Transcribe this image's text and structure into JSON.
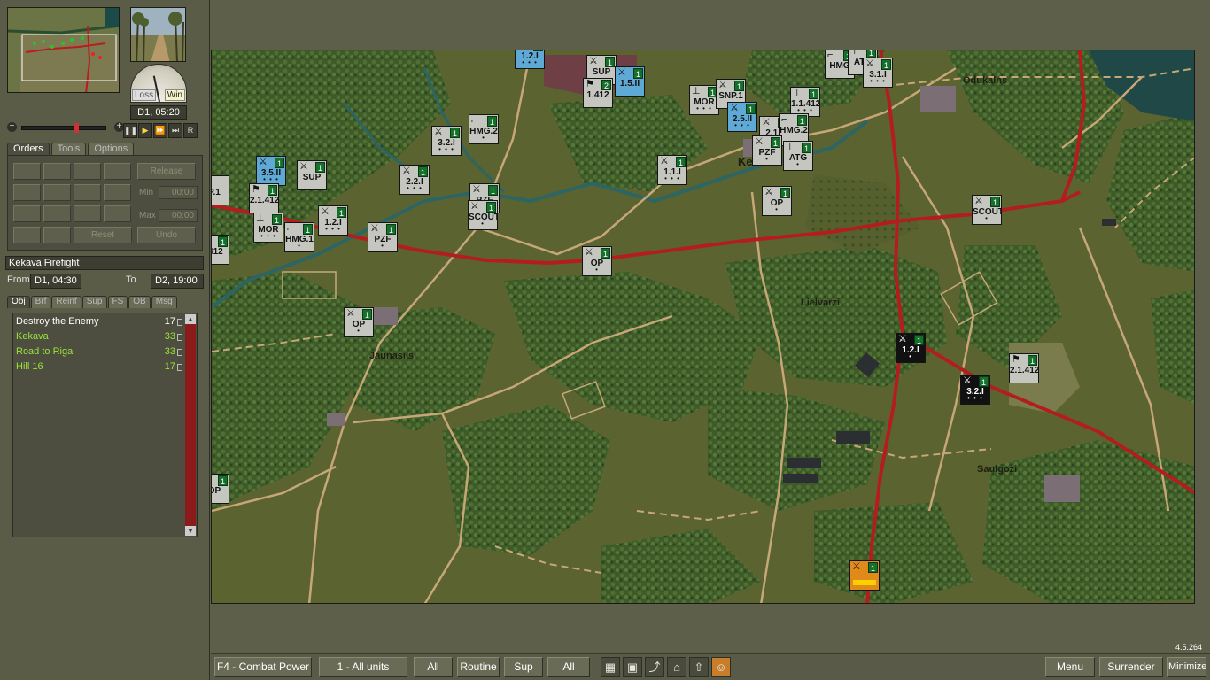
{
  "left_panel": {
    "gauge": {
      "loss_label": "Loss",
      "win_label": "Win"
    },
    "turn_time": "D1, 05:20",
    "playback": {
      "pause": "❚❚",
      "play": "▶",
      "fast": "⏩",
      "faster": "⏭",
      "reset": "R"
    },
    "tabs_top": [
      "Orders",
      "Tools",
      "Options"
    ],
    "orders": {
      "release_label": "Release",
      "min_label": "Min",
      "min_value": "00:00",
      "max_label": "Max",
      "max_value": "00:00",
      "reset_label": "Reset",
      "undo_label": "Undo"
    },
    "scenario_name": "Kekava Firefight",
    "from_label": "From",
    "from_value": "D1, 04:30",
    "to_label": "To",
    "to_value": "D2, 19:00",
    "tabs_bottom": [
      "Obj",
      "Brf",
      "Reinf",
      "Sup",
      "FS",
      "OB",
      "Msg"
    ],
    "objectives": [
      {
        "name": "Destroy the Enemy",
        "points": "17",
        "color": "#ffffff"
      },
      {
        "name": "Kekava",
        "points": "33",
        "color": "#9ae23a"
      },
      {
        "name": "Road to Riga",
        "points": "33",
        "color": "#9ae23a"
      },
      {
        "name": "Hill 16",
        "points": "17",
        "color": "#9ae23a"
      }
    ]
  },
  "map": {
    "towns": [
      {
        "name": "Odukalns"
      },
      {
        "name": "Kekava"
      },
      {
        "name": "Lielvarzi"
      },
      {
        "name": "Jaunasils"
      },
      {
        "name": "Saulgozi"
      }
    ],
    "units": [
      {
        "name": "1.2.I",
        "icon": "infantry-icon",
        "level": "1",
        "size": "• • •",
        "style": "blue"
      },
      {
        "name": "SUP",
        "icon": "infantry-icon",
        "level": "1",
        "size": "",
        "style": "grey"
      },
      {
        "name": "1.5.II",
        "icon": "infantry-icon",
        "level": "1",
        "size": "",
        "style": "blue"
      },
      {
        "name": "1.412",
        "icon": "hq-icon",
        "level": "2",
        "size": "",
        "style": "grey"
      },
      {
        "name": "HMG",
        "icon": "mg-icon",
        "level": "1",
        "size": "",
        "style": "grey"
      },
      {
        "name": "ATG",
        "icon": "gun-icon",
        "level": "1",
        "size": "",
        "style": "grey"
      },
      {
        "name": "3.1.I",
        "icon": "infantry-icon",
        "level": "1",
        "size": "• • •",
        "style": "grey"
      },
      {
        "name": "MOR",
        "icon": "mortar-icon",
        "level": "1",
        "size": "• • •",
        "style": "grey"
      },
      {
        "name": "SNP.1",
        "icon": "infantry-icon",
        "level": "1",
        "size": "",
        "style": "grey"
      },
      {
        "name": "2.5.II",
        "icon": "infantry-icon",
        "level": "1",
        "size": "• • •",
        "style": "blue"
      },
      {
        "name": "1.1.412",
        "icon": "gun-icon",
        "level": "1",
        "size": "• • •",
        "style": "grey"
      },
      {
        "name": "2.1.I",
        "icon": "infantry-icon",
        "level": "1",
        "size": "• • •",
        "style": "grey"
      },
      {
        "name": "HMG.2",
        "icon": "mg-icon",
        "level": "1",
        "size": "",
        "style": "grey"
      },
      {
        "name": "PZF",
        "icon": "infantry-icon",
        "level": "1",
        "size": "•",
        "style": "grey"
      },
      {
        "name": "ATG",
        "icon": "gun-icon",
        "level": "1",
        "size": "•",
        "style": "grey"
      },
      {
        "name": "1.1.I",
        "icon": "infantry-icon",
        "level": "1",
        "size": "• • •",
        "style": "grey"
      },
      {
        "name": "OP",
        "icon": "infantry-icon",
        "level": "1",
        "size": "•",
        "style": "grey"
      },
      {
        "name": "3.2.I",
        "icon": "infantry-icon",
        "level": "1",
        "size": "• • •",
        "style": "grey"
      },
      {
        "name": "HMG.2",
        "icon": "mg-icon",
        "level": "1",
        "size": "•",
        "style": "grey"
      },
      {
        "name": "2.2.I",
        "icon": "infantry-icon",
        "level": "1",
        "size": "• • •",
        "style": "grey"
      },
      {
        "name": "PZF",
        "icon": "infantry-icon",
        "level": "1",
        "size": "•",
        "style": "grey"
      },
      {
        "name": "3.5.II",
        "icon": "infantry-icon",
        "level": "1",
        "size": "• • •",
        "style": "blue"
      },
      {
        "name": "SUP",
        "icon": "infantry-icon",
        "level": "1",
        "size": "",
        "style": "grey"
      },
      {
        "name": "2.1.412",
        "icon": "hq-icon",
        "level": "1",
        "size": "",
        "style": "grey"
      },
      {
        "name": "1.2.I",
        "icon": "infantry-icon",
        "level": "1",
        "size": "• • •",
        "style": "grey"
      },
      {
        "name": "MOR",
        "icon": "mortar-icon",
        "level": "1",
        "size": "• • •",
        "style": "grey"
      },
      {
        "name": "HMG.1",
        "icon": "mg-icon",
        "level": "1",
        "size": "•",
        "style": "grey"
      },
      {
        "name": "PZF",
        "icon": "infantry-icon",
        "level": "1",
        "size": "•",
        "style": "grey"
      },
      {
        "name": "OP",
        "icon": "infantry-icon",
        "level": "1",
        "size": "•",
        "style": "grey"
      },
      {
        "name": "SCOUT",
        "icon": "infantry-icon",
        "level": "1",
        "size": "•",
        "style": "grey"
      },
      {
        "name": "OP",
        "icon": "infantry-icon",
        "level": "1",
        "size": "•",
        "style": "grey"
      },
      {
        "name": "SCOUT",
        "icon": "infantry-icon",
        "level": "1",
        "size": "•",
        "style": "grey"
      },
      {
        "name": "1.2.I",
        "icon": "infantry-icon",
        "level": "1",
        "size": "•",
        "style": "black"
      },
      {
        "name": "3.2.I",
        "icon": "infantry-icon",
        "level": "1",
        "size": "• • •",
        "style": "black"
      },
      {
        "name": "2.1.412",
        "icon": "hq-icon",
        "level": "1",
        "size": "",
        "style": "grey"
      },
      {
        "name": "",
        "icon": "infantry-icon",
        "level": "1",
        "size": "•",
        "style": "orange"
      },
      {
        "name": "P.1",
        "icon": "infantry-icon",
        "level": "",
        "size": "",
        "style": "grey"
      },
      {
        "name": ".412",
        "icon": "hq-icon",
        "level": "1",
        "size": "",
        "style": "grey"
      },
      {
        "name": "OP",
        "icon": "infantry-icon",
        "level": "1",
        "size": "",
        "style": "grey"
      }
    ]
  },
  "bottom_bar": {
    "combat_power": "F4 - Combat Power",
    "unit_filter": "1 - All units",
    "all_1": "All",
    "routine": "Routine",
    "sup": "Sup",
    "all_2": "All",
    "menu": "Menu",
    "surrender": "Surrender",
    "minimize": "Minimize",
    "version": "4.5.264"
  }
}
